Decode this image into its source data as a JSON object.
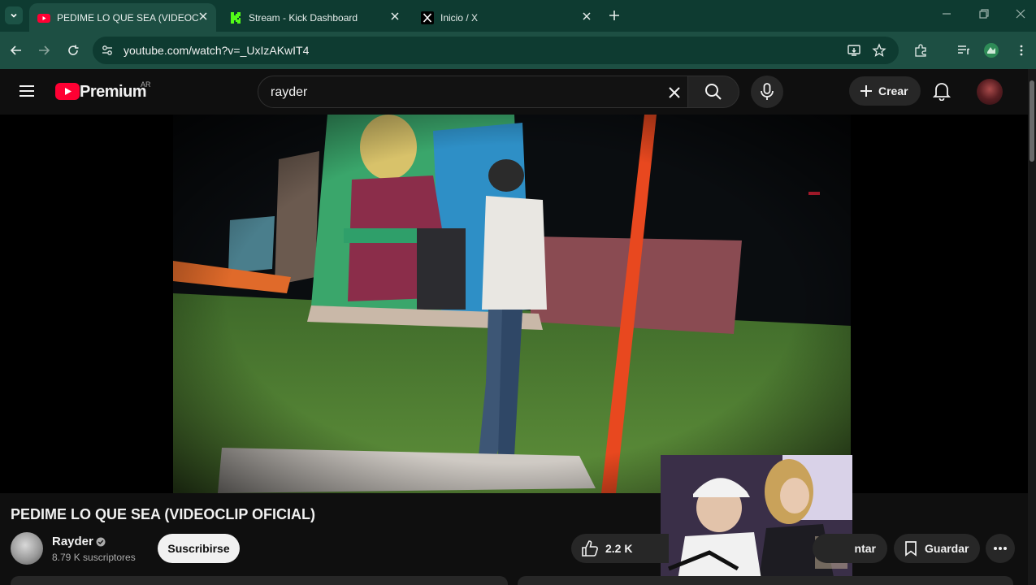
{
  "browser": {
    "tabs": [
      {
        "title": "PEDIME LO QUE SEA (VIDEOCLIP OFICIAL) - YouTube",
        "active": true,
        "favicon": "youtube-icon"
      },
      {
        "title": "Stream - Kick Dashboard",
        "active": false,
        "favicon": "kick-icon"
      },
      {
        "title": "Inicio / X",
        "active": false,
        "favicon": "x-icon"
      }
    ],
    "url": "youtube.com/watch?v=_UxIzAKwIT4"
  },
  "youtube": {
    "logo_text": "Premium",
    "region": "AR",
    "search_query": "rayder",
    "create_label": "Crear"
  },
  "video": {
    "title": "PEDIME LO QUE SEA (VIDEOCLIP OFICIAL)",
    "channel_name": "Rayder",
    "subscribers": "8.79 K suscriptores",
    "subscribe_label": "Suscribirse",
    "likes": "2.2 K",
    "share_label": "ntar",
    "save_label": "Guardar"
  },
  "colors": {
    "tab_strip": "#0e3b31",
    "toolbar": "#1d4f43",
    "yt_red": "#ff0033",
    "kick_green": "#53fc18"
  }
}
